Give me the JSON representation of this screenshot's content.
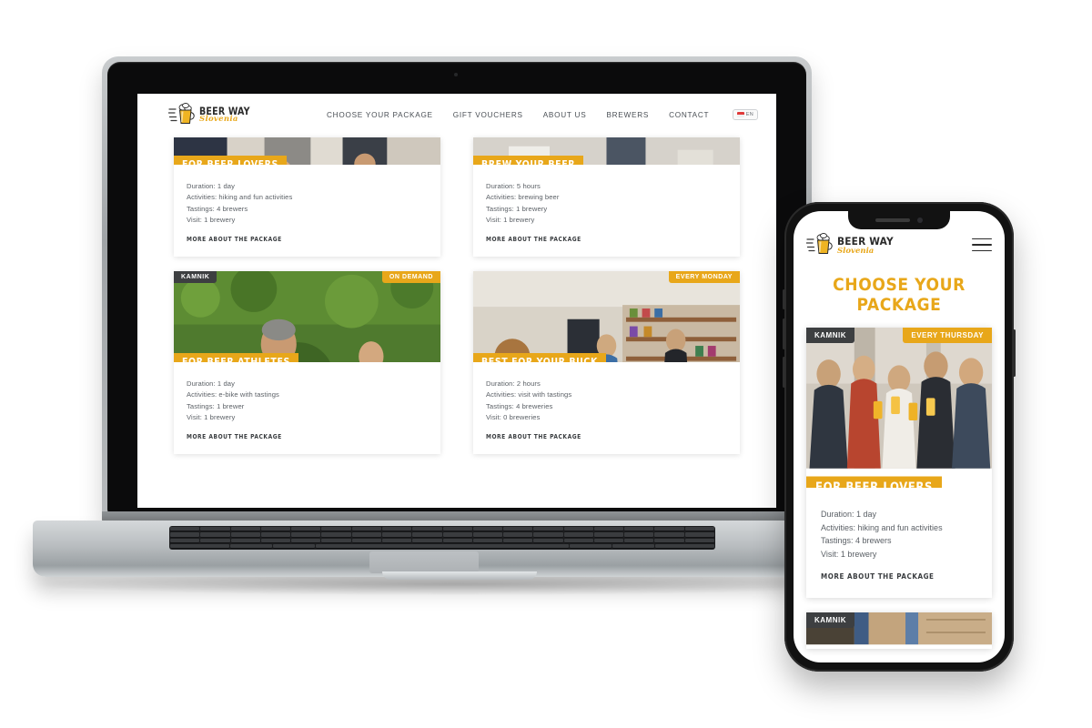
{
  "brand": {
    "name_main": "BEER WAY",
    "name_sub": "Slovenia",
    "logo_icon": "beer-mug-icon",
    "accent_color": "#e8a71a",
    "dark_badge_color": "#3d3f41",
    "text_color": "#5b6066"
  },
  "desktop": {
    "nav": {
      "links": [
        {
          "label": "CHOOSE YOUR PACKAGE"
        },
        {
          "label": "GIFT VOUCHERS"
        },
        {
          "label": "ABOUT US"
        },
        {
          "label": "BREWERS"
        },
        {
          "label": "CONTACT"
        }
      ],
      "language": {
        "code": "EN",
        "flag_icon": "flag-icon"
      }
    },
    "cards": [
      {
        "title": "FOR BEER LOVERS",
        "location_badge": null,
        "schedule_badge": null,
        "duration": "Duration: 1 day",
        "activities": "Activities: hiking and fun activities",
        "tastings": "Tastings: 4 brewers",
        "visit": "Visit: 1 brewery",
        "cta": "MORE ABOUT THE PACKAGE",
        "photo": "group-of-people-outdoors"
      },
      {
        "title": "BREW YOUR BEER",
        "location_badge": null,
        "schedule_badge": null,
        "duration": "Duration: 5 hours",
        "activities": "Activities: brewing beer",
        "tastings": "Tastings: 1 brewery",
        "visit": "Visit: 1 brewery",
        "cta": "MORE ABOUT THE PACKAGE",
        "photo": "brewery-floor"
      },
      {
        "title": "FOR BEER ATHLETES",
        "location_badge": "KAMNIK",
        "schedule_badge": "ON DEMAND",
        "duration": "Duration: 1 day",
        "activities": "Activities: e-bike with tastings",
        "tastings": "Tastings: 1 brewer",
        "visit": "Visit: 1 brewery",
        "cta": "MORE ABOUT THE PACKAGE",
        "photo": "man-in-hop-field"
      },
      {
        "title": "BEST FOR YOUR BUCK",
        "location_badge": null,
        "schedule_badge": "EVERY MONDAY",
        "duration": "Duration: 2 hours",
        "activities": "Activities: visit with tastings",
        "tastings": "Tastings: 4 breweries",
        "visit": "Visit: 0 breweries",
        "cta": "MORE ABOUT THE PACKAGE",
        "photo": "people-in-beer-shop"
      }
    ]
  },
  "mobile": {
    "menu_icon": "hamburger-menu-icon",
    "page_title": "CHOOSE YOUR PACKAGE",
    "card": {
      "title": "FOR BEER LOVERS",
      "location_badge": "KAMNIK",
      "schedule_badge": "EVERY THURSDAY",
      "duration": "Duration: 1 day",
      "activities": "Activities: hiking and fun activities",
      "tastings": "Tastings: 4 brewers",
      "visit": "Visit: 1 brewery",
      "cta": "MORE ABOUT THE PACKAGE",
      "photo": "people-toasting-with-beer"
    },
    "next_card": {
      "location_badge": "KAMNIK",
      "photo": "brewery-storage"
    }
  }
}
